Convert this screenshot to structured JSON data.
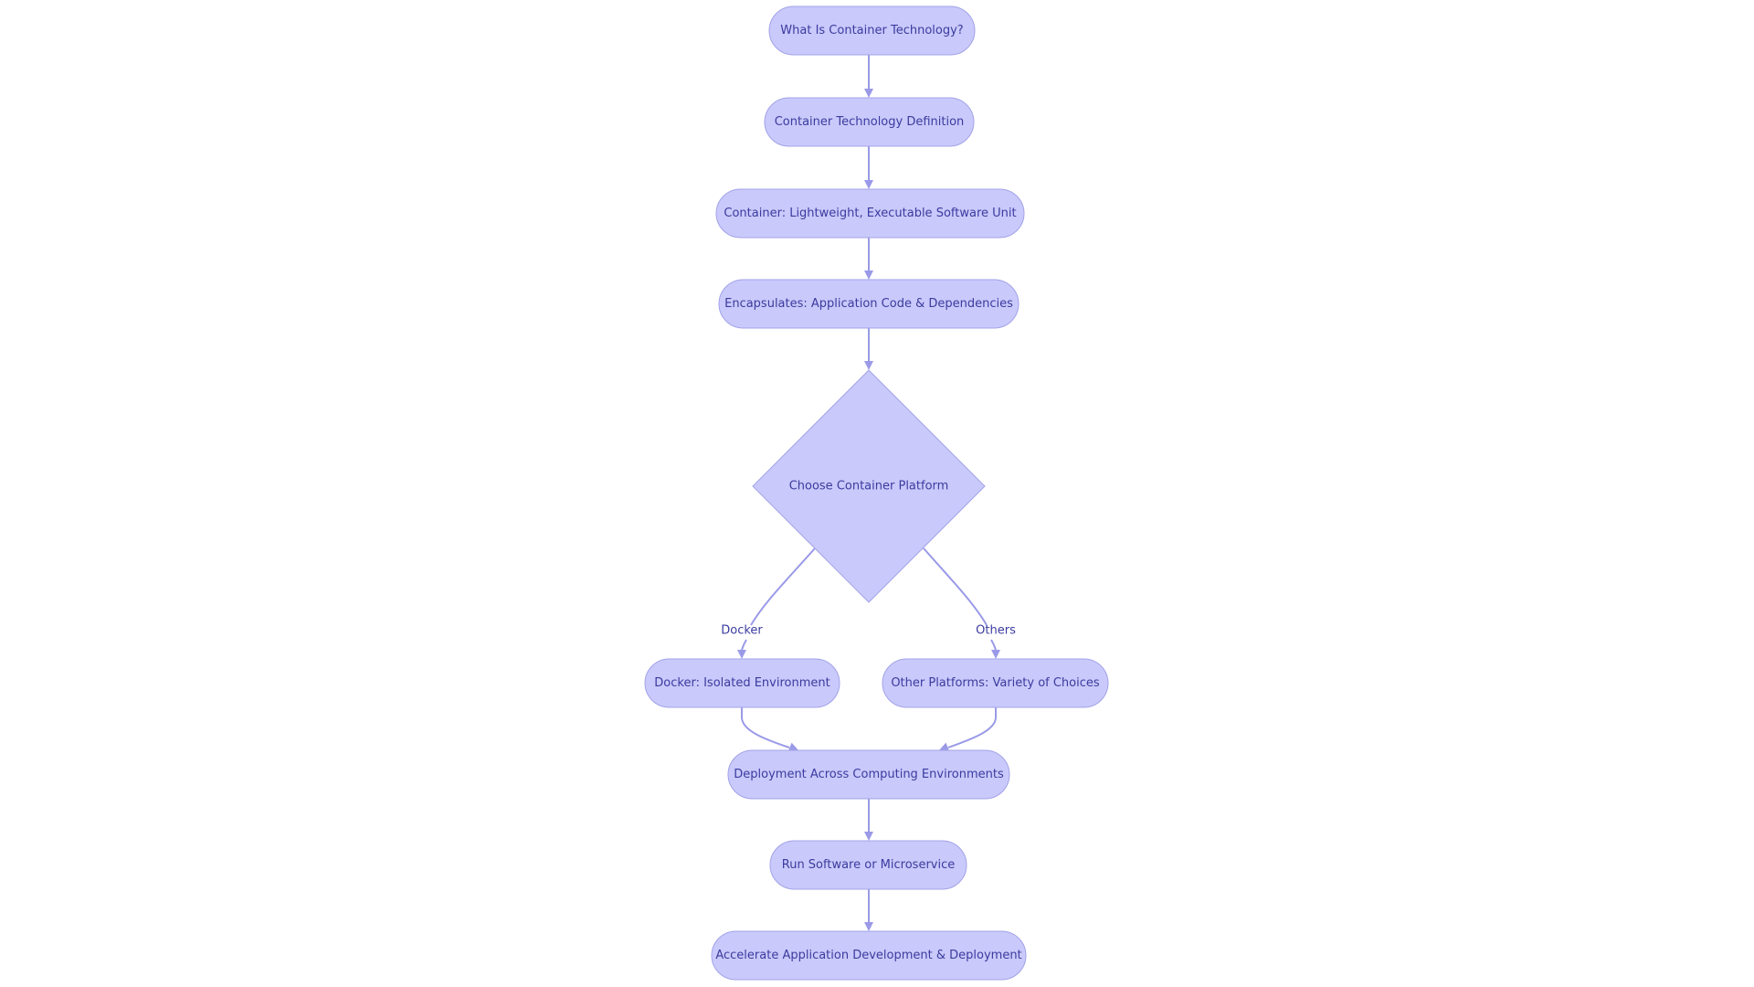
{
  "diagram": {
    "type": "flowchart",
    "direction": "top-down",
    "colors": {
      "node_fill": "#c9c9fb",
      "node_border": "#a3a3e8",
      "edge": "#9a9ae8",
      "text": "#3b3b9f",
      "background": "#ffffff"
    },
    "nodes": [
      {
        "id": "n1",
        "shape": "stadium",
        "label": "What Is Container Technology?"
      },
      {
        "id": "n2",
        "shape": "stadium",
        "label": "Container Technology Definition"
      },
      {
        "id": "n3",
        "shape": "stadium",
        "label": "Container: Lightweight, Executable Software Unit"
      },
      {
        "id": "n4",
        "shape": "stadium",
        "label": "Encapsulates: Application Code & Dependencies"
      },
      {
        "id": "n5",
        "shape": "diamond",
        "label": "Choose Container Platform"
      },
      {
        "id": "n6",
        "shape": "stadium",
        "label": "Docker: Isolated Environment"
      },
      {
        "id": "n7",
        "shape": "stadium",
        "label": "Other Platforms: Variety of Choices"
      },
      {
        "id": "n8",
        "shape": "stadium",
        "label": "Deployment Across Computing Environments"
      },
      {
        "id": "n9",
        "shape": "stadium",
        "label": "Run Software or Microservice"
      },
      {
        "id": "n10",
        "shape": "stadium",
        "label": "Accelerate Application Development & Deployment"
      }
    ],
    "edges": [
      {
        "from": "n1",
        "to": "n2",
        "label": ""
      },
      {
        "from": "n2",
        "to": "n3",
        "label": ""
      },
      {
        "from": "n3",
        "to": "n4",
        "label": ""
      },
      {
        "from": "n4",
        "to": "n5",
        "label": ""
      },
      {
        "from": "n5",
        "to": "n6",
        "label": "Docker"
      },
      {
        "from": "n5",
        "to": "n7",
        "label": "Others"
      },
      {
        "from": "n6",
        "to": "n8",
        "label": ""
      },
      {
        "from": "n7",
        "to": "n8",
        "label": ""
      },
      {
        "from": "n8",
        "to": "n9",
        "label": ""
      },
      {
        "from": "n9",
        "to": "n10",
        "label": ""
      }
    ]
  }
}
